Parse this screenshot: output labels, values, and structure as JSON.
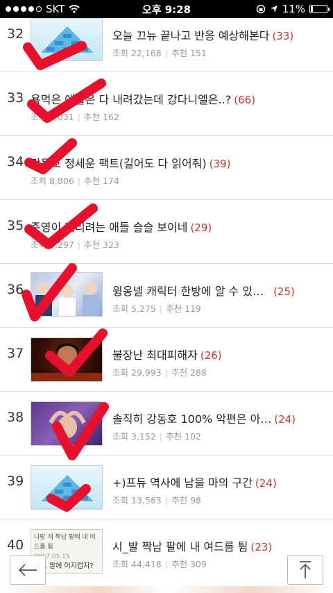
{
  "status_bar": {
    "carrier": "SKT",
    "time": "오후 9:28",
    "battery": "11%"
  },
  "posts": [
    {
      "num": "32",
      "title": "오늘 끄뉴 끝나고 반응 예상해본다",
      "comments": "(33)",
      "views_label": "조회",
      "views": "22,168",
      "rec_label": "추천",
      "rec": "151"
    },
    {
      "num": "33",
      "title": "욕먹은 애들은 다 내려갔는데 강다니엘은..?",
      "comments": "(66)",
      "views_label": "조회",
      "views": "8,031",
      "rec_label": "추천",
      "rec": "162"
    },
    {
      "num": "34",
      "title": "강동호 정세운 팩트(길어도 다 읽어줘)",
      "comments": "(39)",
      "views_label": "조회",
      "views": "8,806",
      "rec_label": "추천",
      "rec": "174"
    },
    {
      "num": "35",
      "title": "준영이 버리려는 애들 슬슬 보이네",
      "comments": "(29)",
      "views_label": "조회",
      "views": "4,297",
      "rec_label": "추천",
      "rec": "323"
    },
    {
      "num": "36",
      "title": "윙옹넬 캐릭터 한방에 알 수 있…",
      "comments": "(25)",
      "views_label": "조회",
      "views": "5,275",
      "rec_label": "추천",
      "rec": "119"
    },
    {
      "num": "37",
      "title": "불장난 최대피해자",
      "comments": "(26)",
      "views_label": "조회",
      "views": "29,993",
      "rec_label": "추천",
      "rec": "288"
    },
    {
      "num": "38",
      "title": "솔직히 강동호 100% 악편은 아…",
      "comments": "(24)",
      "views_label": "조회",
      "views": "3,152",
      "rec_label": "추천",
      "rec": "102"
    },
    {
      "num": "39",
      "title": "+)프듀 역사에 남을 마의 구간",
      "comments": "(24)",
      "views_label": "조회",
      "views": "13,563",
      "rec_label": "추천",
      "rec": "98"
    },
    {
      "num": "40",
      "title": "시_발 짝남 팔에 내 여드름 튐",
      "comments": "(23)",
      "views_label": "조회",
      "views": "44,418",
      "rec_label": "추천",
      "rec": "309"
    }
  ],
  "thumb_text_40": {
    "line1": "나랑 걔 짝남 팔에 내 여드름 튐",
    "line2": "2017.05.15",
    "line3": "아... 팔에 어지럽지?"
  },
  "nav": {
    "back_icon": "arrow-left-icon",
    "top_icon": "arrow-up-icon"
  },
  "colors": {
    "comment_count": "#c0392b",
    "checkmark": "#e8112d"
  }
}
